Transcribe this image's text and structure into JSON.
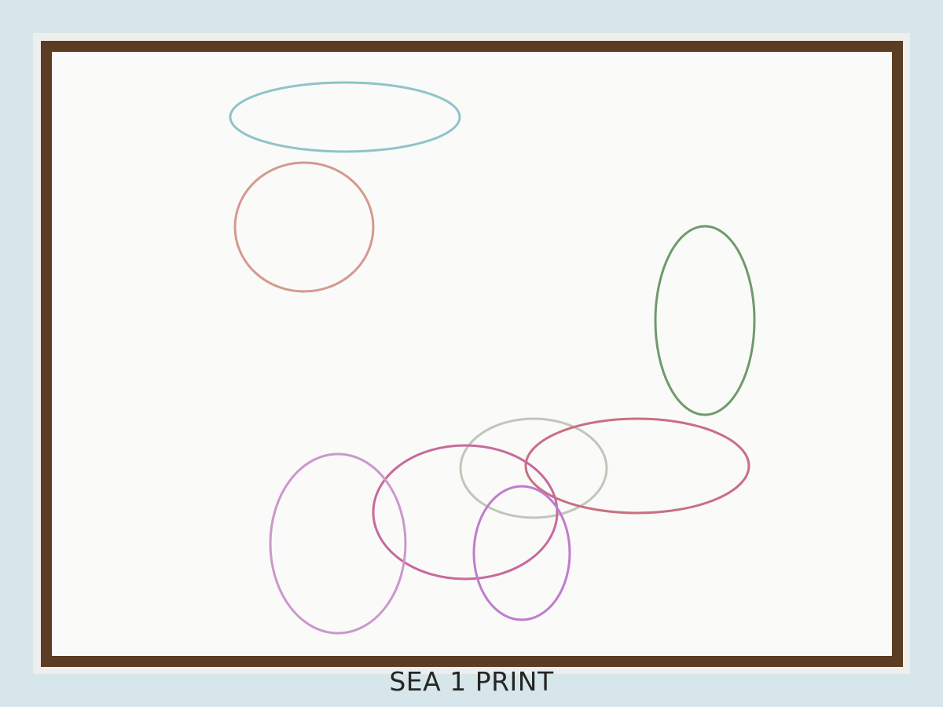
{
  "caption": "SEA 1 PRINT",
  "ellipse_colors": {
    "teal": "#8fc4c8",
    "rose": "#d49a8e",
    "green": "#6f9a6c",
    "gray": "#c2c6b9",
    "crimson": "#c87080",
    "magenta": "#c76a9c",
    "lavender": "#cb98cc",
    "violet": "#c07ccd"
  }
}
